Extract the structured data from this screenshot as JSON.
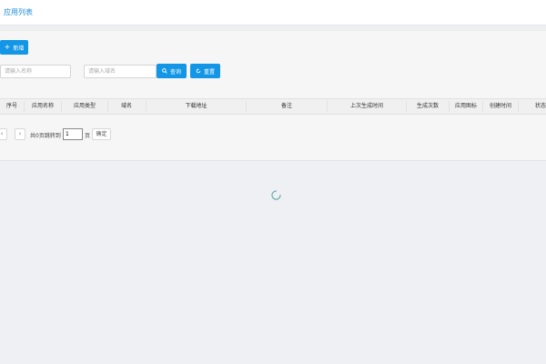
{
  "header": {
    "title": "应用列表"
  },
  "toolbar": {
    "add_label": "新增",
    "add_icon": "plus-icon"
  },
  "search": {
    "name_placeholder": "请输入名称",
    "domain_placeholder": "请输入域名",
    "query_label": "查询",
    "reset_label": "重置",
    "query_icon": "search-icon",
    "reset_icon": "refresh-icon"
  },
  "table": {
    "columns": [
      "序号",
      "应用名称",
      "应用类型",
      "域名",
      "下载地址",
      "备注",
      "上次生成时间",
      "生成次数",
      "应用图标",
      "创建时间",
      "状态"
    ]
  },
  "pagination": {
    "prev": "‹",
    "next": "›",
    "total_text": "共0页跳转到",
    "page_value": "1",
    "page_unit": "页",
    "confirm_label": "确定"
  },
  "colors": {
    "accent": "#1496e6",
    "title": "#1f8fdc",
    "spinner": "#5aa5a5"
  }
}
